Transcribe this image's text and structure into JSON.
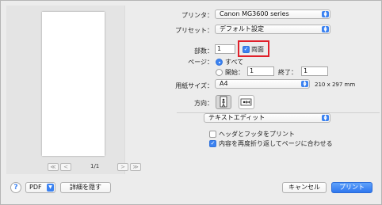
{
  "preview": {
    "first_label": "≪",
    "prev_label": "<",
    "page_counter": "1/1",
    "next_label": ">",
    "last_label": "≫"
  },
  "printer": {
    "label": "プリンタ：",
    "value": "Canon MG3600 series"
  },
  "preset": {
    "label": "プリセット：",
    "value": "デフォルト設定"
  },
  "copies": {
    "label": "部数：",
    "value": "1",
    "duplex_label": "両面",
    "duplex_checked": true
  },
  "pages": {
    "label": "ページ：",
    "all_label": "すべて",
    "from_label": "開始：",
    "from_value": "1",
    "to_label": "終了：",
    "to_value": "1",
    "selected": "all"
  },
  "paper_size": {
    "label": "用紙サイズ：",
    "value": "A4",
    "dimensions": "210 x 297 mm"
  },
  "orientation": {
    "label": "方向：",
    "selected": "portrait"
  },
  "app_section": {
    "value": "テキストエディット"
  },
  "options": {
    "header_footer_label": "ヘッダとフッタをプリント",
    "header_footer_checked": false,
    "rewrap_label": "内容を再度折り返してページに合わせる",
    "rewrap_checked": true
  },
  "footer": {
    "help_label": "?",
    "pdf_label": "PDF",
    "hide_details_label": "詳細を隠す",
    "cancel_label": "キャンセル",
    "print_label": "プリント"
  },
  "colors": {
    "accent": "#3b82f1",
    "highlight": "#e0202a"
  }
}
